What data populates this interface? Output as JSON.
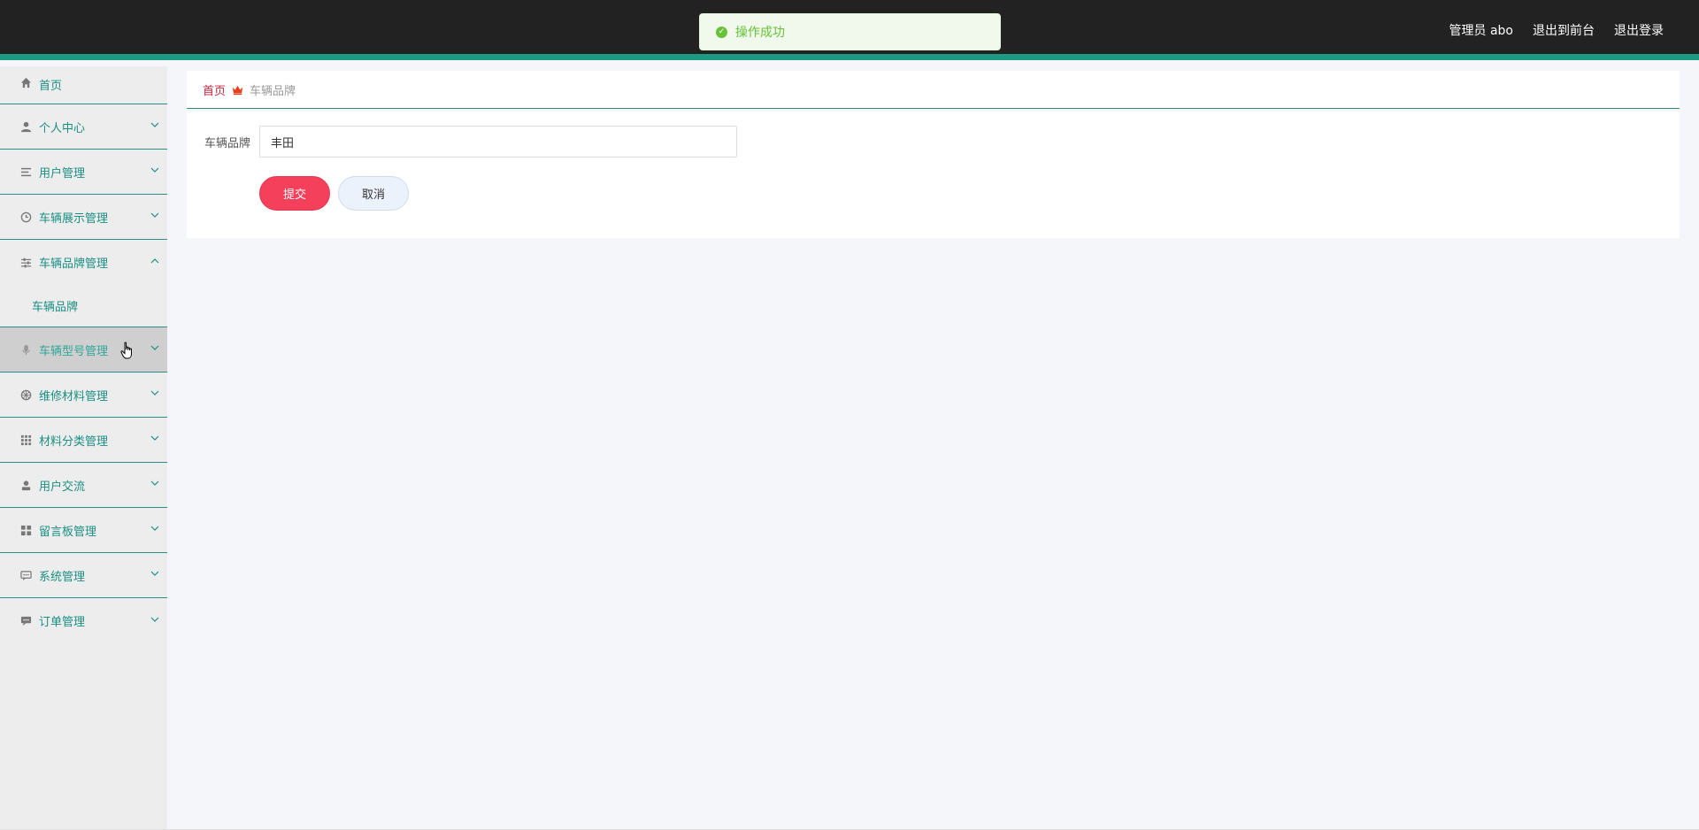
{
  "header": {
    "user_label": "管理员 abo",
    "to_front_label": "退出到前台",
    "logout_label": "退出登录"
  },
  "toast": {
    "message": "操作成功"
  },
  "sidebar": {
    "items": [
      {
        "label": "首页",
        "icon": "home-icon"
      },
      {
        "label": "个人中心",
        "icon": "person-icon"
      },
      {
        "label": "用户管理",
        "icon": "list-icon"
      },
      {
        "label": "车辆展示管理",
        "icon": "clock-icon"
      },
      {
        "label": "车辆品牌管理",
        "icon": "sliders-icon",
        "expanded": true,
        "children": [
          "车辆品牌"
        ]
      },
      {
        "label": "车辆型号管理",
        "icon": "mic-icon",
        "hovered": true
      },
      {
        "label": "维修材料管理",
        "icon": "compass-icon"
      },
      {
        "label": "材料分类管理",
        "icon": "grid-icon"
      },
      {
        "label": "用户交流",
        "icon": "user-icon"
      },
      {
        "label": "留言板管理",
        "icon": "dashboard-icon"
      },
      {
        "label": "系统管理",
        "icon": "chat-icon"
      },
      {
        "label": "订单管理",
        "icon": "message-icon"
      }
    ]
  },
  "breadcrumb": {
    "home": "首页",
    "current": "车辆品牌"
  },
  "form": {
    "brand_label": "车辆品牌",
    "brand_value": "丰田",
    "submit_label": "提交",
    "cancel_label": "取消"
  },
  "colors": {
    "accent": "#1f9a82",
    "submit": "#f4405a",
    "success": "#67c23a",
    "header_bg": "#222222"
  }
}
